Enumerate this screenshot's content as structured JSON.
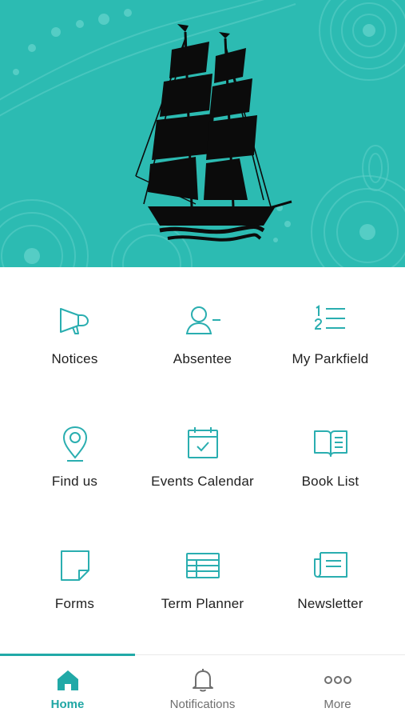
{
  "theme": {
    "accent": "#21a9a7",
    "hero_bg": "#2cbbb2",
    "icon_color": "#2aaeb0"
  },
  "header": {
    "banner": "ship-logo"
  },
  "tiles": [
    {
      "label": "Notices",
      "icon": "megaphone-icon"
    },
    {
      "label": "Absentee",
      "icon": "user-minus-icon"
    },
    {
      "label": "My Parkfield",
      "icon": "numbered-list-icon"
    },
    {
      "label": "Find us",
      "icon": "map-pin-icon"
    },
    {
      "label": "Events Calendar",
      "icon": "calendar-check-icon"
    },
    {
      "label": "Book List",
      "icon": "open-book-icon"
    },
    {
      "label": "Forms",
      "icon": "note-page-icon"
    },
    {
      "label": "Term Planner",
      "icon": "table-icon"
    },
    {
      "label": "Newsletter",
      "icon": "newspaper-icon"
    }
  ],
  "tabbar": {
    "active": "Home",
    "tabs": [
      {
        "label": "Home",
        "icon": "home-icon"
      },
      {
        "label": "Notifications",
        "icon": "bell-icon"
      },
      {
        "label": "More",
        "icon": "more-dots-icon"
      }
    ]
  }
}
